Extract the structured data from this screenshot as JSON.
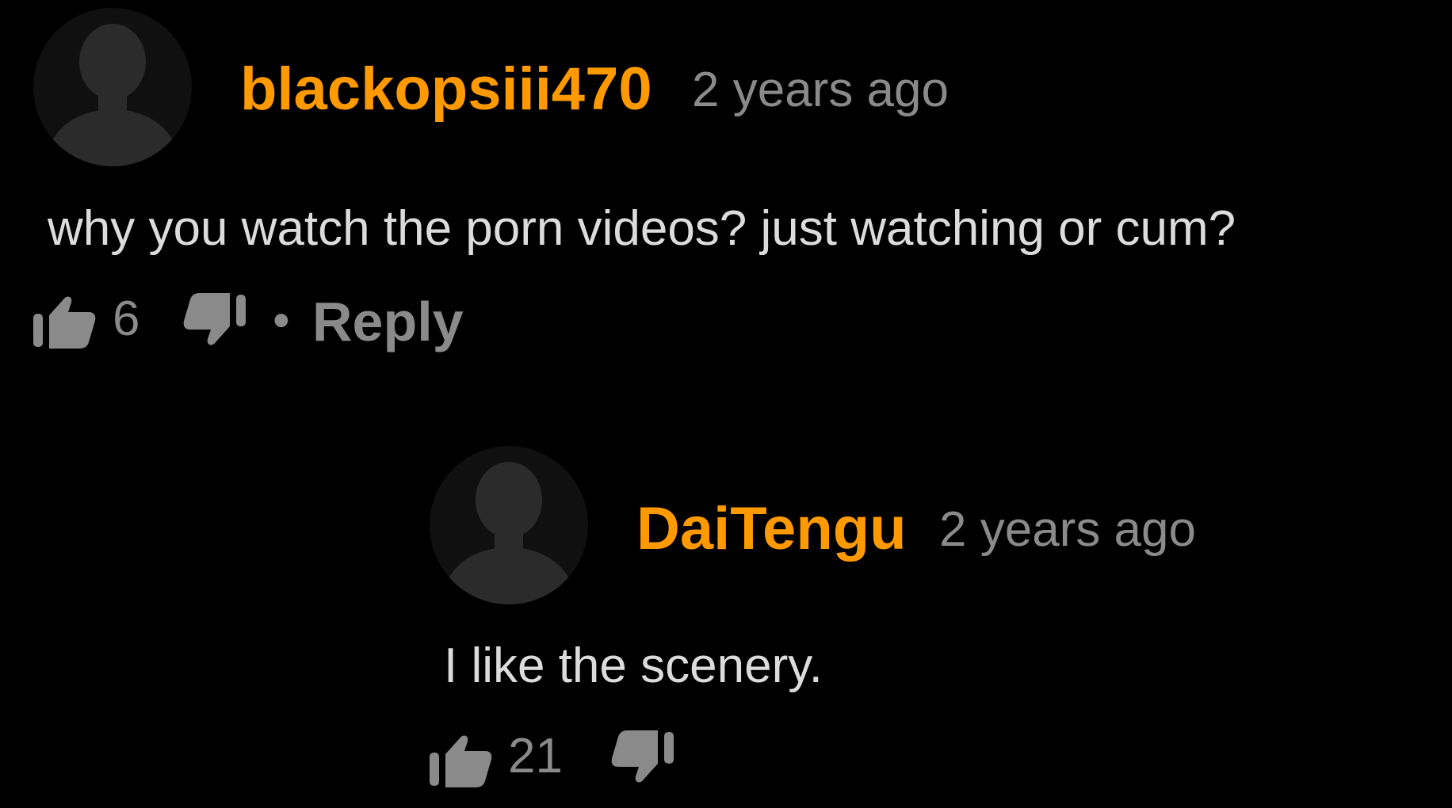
{
  "colors": {
    "background": "#000000",
    "username": "#ff9900",
    "meta": "#8a8a8a",
    "body": "#dcdcdc",
    "icon": "#8a8a8a",
    "avatar_bg": "#101010",
    "avatar_silhouette": "#2b2b2b"
  },
  "comments": [
    {
      "username": "blackopsiii470",
      "timestamp": "2 years ago",
      "text": "why you watch the porn videos? just watching or cum?",
      "like_count": "6",
      "separator": "•",
      "reply_label": "Reply",
      "avatar_icon": "person-silhouette-icon",
      "like_icon": "thumbs-up-icon",
      "dislike_icon": "thumbs-down-icon"
    },
    {
      "username": "DaiTengu",
      "timestamp": "2 years ago",
      "text": "I like the scenery.",
      "like_count": "21",
      "avatar_icon": "person-silhouette-icon",
      "like_icon": "thumbs-up-icon",
      "dislike_icon": "thumbs-down-icon"
    }
  ]
}
